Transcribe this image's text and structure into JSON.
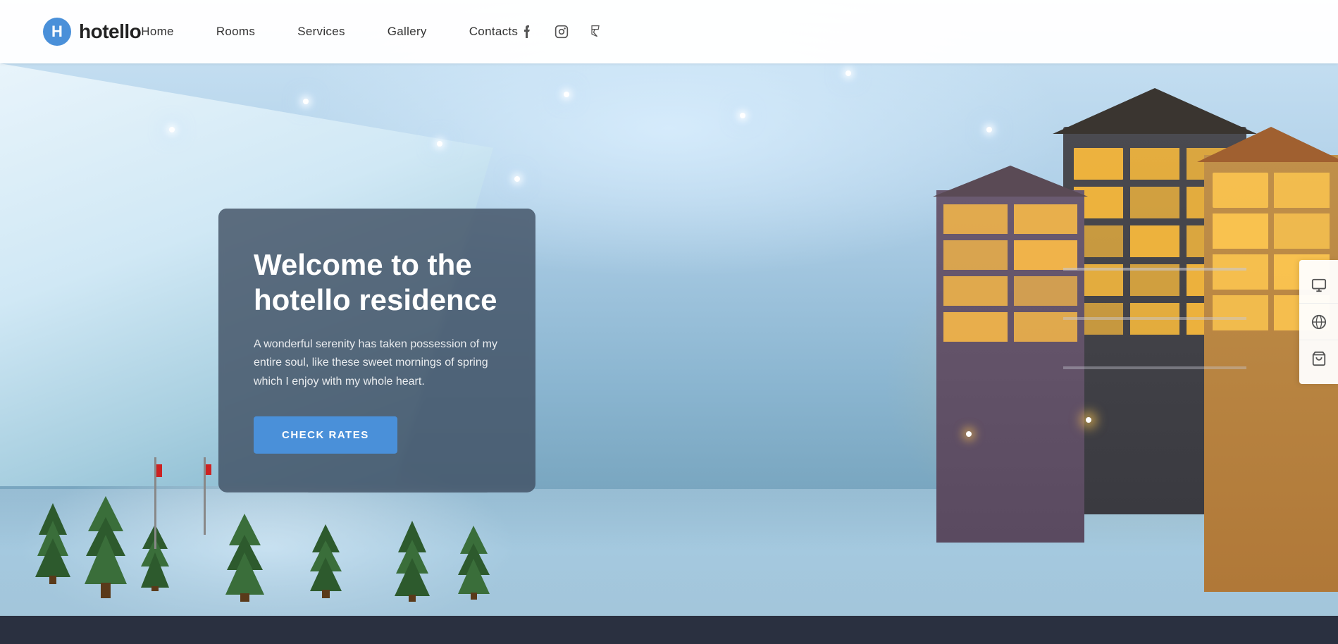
{
  "header": {
    "logo_text": "hotello",
    "nav_items": [
      {
        "label": "Home",
        "href": "#"
      },
      {
        "label": "Rooms",
        "href": "#"
      },
      {
        "label": "Services",
        "href": "#"
      },
      {
        "label": "Gallery",
        "href": "#"
      },
      {
        "label": "Contacts",
        "href": "#"
      }
    ],
    "social": [
      {
        "name": "facebook",
        "icon": "f"
      },
      {
        "name": "instagram",
        "icon": "📷"
      },
      {
        "name": "foursquare",
        "icon": "⚑"
      }
    ]
  },
  "hero": {
    "card": {
      "title": "Welcome to the hotello residence",
      "subtitle": "A wonderful serenity has taken possession of my entire soul, like these sweet mornings of spring which I enjoy with my whole heart.",
      "cta_label": "CHECK RATES"
    }
  },
  "sidebar_right": {
    "items": [
      {
        "name": "monitor-icon",
        "symbol": "🖥"
      },
      {
        "name": "globe-icon",
        "symbol": "🌐"
      },
      {
        "name": "cart-icon",
        "symbol": "🛒"
      }
    ]
  }
}
